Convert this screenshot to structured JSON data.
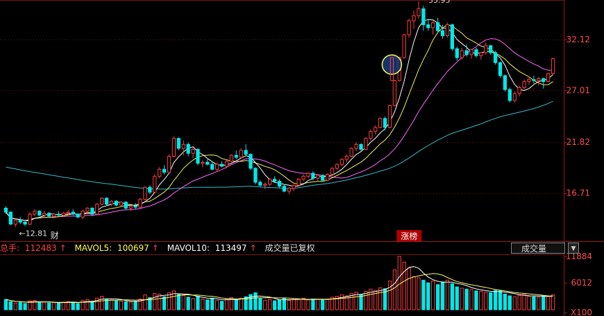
{
  "chart_data": [
    {
      "type": "candlestick",
      "title": "",
      "y_ticks": [
        "32.12",
        "27.01",
        "21.82",
        "16.71"
      ],
      "y_tick_values": [
        32.12,
        27.01,
        21.82,
        16.71
      ],
      "ylim": [
        12.0,
        36.0
      ],
      "annotations": {
        "low": "12.81",
        "high": "35.95",
        "low_tag": "财",
        "high_tag": "涨榜"
      },
      "ohlc": [
        [
          15.2,
          15.4,
          14.6,
          14.8
        ],
        [
          14.8,
          14.9,
          13.5,
          13.6
        ],
        [
          13.6,
          14.2,
          13.3,
          14.0
        ],
        [
          14.0,
          14.3,
          13.6,
          13.8
        ],
        [
          13.8,
          14.0,
          13.4,
          13.6
        ],
        [
          13.6,
          14.8,
          13.5,
          14.6
        ],
        [
          14.6,
          15.1,
          14.4,
          14.9
        ],
        [
          14.9,
          15.0,
          14.4,
          14.5
        ],
        [
          14.5,
          14.9,
          14.3,
          14.7
        ],
        [
          14.7,
          14.8,
          14.3,
          14.4
        ],
        [
          14.4,
          14.7,
          14.2,
          14.6
        ],
        [
          14.6,
          14.9,
          14.4,
          14.5
        ],
        [
          14.5,
          14.8,
          14.3,
          14.7
        ],
        [
          14.7,
          15.0,
          14.5,
          14.8
        ],
        [
          14.8,
          15.1,
          14.5,
          14.6
        ],
        [
          14.6,
          14.7,
          14.2,
          14.3
        ],
        [
          14.3,
          15.0,
          14.1,
          14.9
        ],
        [
          14.9,
          15.3,
          14.6,
          15.2
        ],
        [
          15.2,
          15.3,
          14.4,
          14.6
        ],
        [
          14.6,
          15.7,
          14.5,
          15.6
        ],
        [
          15.6,
          16.3,
          15.5,
          16.2
        ],
        [
          16.2,
          16.3,
          15.4,
          15.6
        ],
        [
          15.6,
          16.0,
          15.4,
          15.9
        ],
        [
          15.9,
          16.0,
          15.4,
          15.5
        ],
        [
          15.5,
          15.9,
          15.3,
          15.8
        ],
        [
          15.8,
          15.9,
          15.0,
          15.2
        ],
        [
          15.2,
          15.5,
          14.9,
          15.4
        ],
        [
          15.4,
          15.7,
          15.1,
          15.3
        ],
        [
          15.3,
          16.2,
          15.2,
          16.1
        ],
        [
          16.1,
          17.4,
          16.0,
          17.3
        ],
        [
          17.3,
          17.5,
          16.6,
          16.8
        ],
        [
          16.8,
          18.6,
          16.7,
          18.4
        ],
        [
          18.4,
          19.3,
          18.2,
          19.1
        ],
        [
          19.1,
          19.5,
          18.6,
          18.8
        ],
        [
          18.8,
          20.6,
          18.7,
          20.4
        ],
        [
          20.4,
          22.4,
          20.3,
          22.2
        ],
        [
          22.2,
          22.3,
          21.0,
          21.2
        ],
        [
          21.2,
          22.0,
          20.5,
          21.6
        ],
        [
          21.6,
          21.8,
          20.4,
          20.7
        ],
        [
          20.7,
          21.3,
          20.2,
          21.1
        ],
        [
          21.1,
          21.2,
          19.5,
          19.7
        ],
        [
          19.7,
          20.0,
          19.3,
          19.8
        ],
        [
          19.8,
          20.1,
          19.5,
          19.6
        ],
        [
          19.6,
          19.9,
          19.0,
          19.1
        ],
        [
          19.1,
          19.8,
          18.9,
          19.6
        ],
        [
          19.6,
          19.9,
          19.3,
          19.4
        ],
        [
          19.4,
          20.0,
          19.2,
          19.9
        ],
        [
          19.9,
          20.6,
          19.8,
          20.5
        ],
        [
          20.5,
          21.0,
          20.1,
          20.3
        ],
        [
          20.3,
          21.2,
          20.2,
          21.0
        ],
        [
          21.0,
          21.6,
          20.4,
          20.6
        ],
        [
          20.6,
          20.7,
          19.0,
          19.2
        ],
        [
          19.2,
          19.3,
          17.6,
          17.8
        ],
        [
          17.8,
          18.0,
          17.3,
          17.5
        ],
        [
          17.5,
          17.8,
          17.1,
          17.6
        ],
        [
          17.6,
          18.2,
          17.4,
          18.1
        ],
        [
          18.1,
          18.4,
          17.8,
          17.9
        ],
        [
          17.9,
          18.1,
          17.2,
          17.4
        ],
        [
          17.4,
          17.6,
          16.8,
          16.9
        ],
        [
          16.9,
          17.3,
          16.6,
          17.2
        ],
        [
          17.2,
          17.6,
          16.9,
          17.5
        ],
        [
          17.5,
          18.2,
          17.4,
          18.1
        ],
        [
          18.1,
          18.6,
          17.9,
          18.4
        ],
        [
          18.4,
          18.8,
          18.2,
          18.7
        ],
        [
          18.7,
          18.9,
          18.0,
          18.2
        ],
        [
          18.2,
          18.6,
          17.9,
          18.5
        ],
        [
          18.5,
          18.6,
          17.9,
          18.0
        ],
        [
          18.0,
          18.7,
          17.9,
          18.6
        ],
        [
          18.6,
          19.3,
          18.5,
          19.2
        ],
        [
          19.2,
          19.7,
          19.0,
          19.6
        ],
        [
          19.6,
          20.2,
          19.4,
          20.1
        ],
        [
          20.1,
          20.6,
          19.8,
          20.4
        ],
        [
          20.4,
          21.3,
          20.3,
          21.2
        ],
        [
          21.2,
          21.8,
          20.9,
          21.6
        ],
        [
          21.6,
          21.7,
          20.9,
          21.1
        ],
        [
          21.1,
          22.3,
          21.0,
          22.2
        ],
        [
          22.2,
          23.1,
          22.0,
          22.9
        ],
        [
          22.9,
          23.5,
          22.6,
          23.3
        ],
        [
          23.3,
          24.3,
          23.2,
          24.2
        ],
        [
          24.2,
          24.4,
          23.0,
          23.3
        ],
        [
          23.3,
          25.6,
          23.2,
          25.5
        ],
        [
          25.5,
          28.1,
          25.4,
          28.0
        ],
        [
          28.0,
          30.4,
          27.9,
          30.3
        ],
        [
          30.3,
          32.7,
          30.2,
          32.6
        ],
        [
          32.6,
          34.2,
          32.3,
          34.0
        ],
        [
          34.0,
          35.0,
          33.2,
          34.5
        ],
        [
          34.5,
          35.95,
          34.2,
          35.2
        ],
        [
          35.2,
          35.5,
          33.0,
          33.6
        ],
        [
          33.6,
          34.2,
          33.0,
          33.3
        ],
        [
          33.3,
          34.0,
          32.6,
          33.8
        ],
        [
          33.8,
          34.3,
          32.8,
          33.0
        ],
        [
          33.0,
          33.6,
          32.2,
          32.5
        ],
        [
          32.5,
          33.8,
          32.3,
          33.6
        ],
        [
          33.6,
          33.7,
          31.0,
          31.2
        ],
        [
          31.2,
          31.4,
          30.0,
          30.3
        ],
        [
          30.3,
          31.3,
          30.1,
          31.0
        ],
        [
          31.0,
          31.6,
          30.4,
          30.6
        ],
        [
          30.6,
          31.2,
          30.2,
          31.1
        ],
        [
          31.1,
          31.3,
          30.3,
          30.5
        ],
        [
          30.5,
          30.9,
          30.1,
          30.8
        ],
        [
          30.8,
          31.8,
          30.6,
          31.5
        ],
        [
          31.5,
          31.6,
          30.6,
          30.8
        ],
        [
          30.8,
          31.0,
          29.6,
          29.8
        ],
        [
          29.8,
          29.9,
          28.3,
          28.5
        ],
        [
          28.5,
          28.6,
          26.9,
          27.1
        ],
        [
          27.1,
          27.3,
          25.8,
          26.0
        ],
        [
          26.0,
          26.9,
          25.8,
          26.7
        ],
        [
          26.7,
          27.5,
          26.4,
          27.3
        ],
        [
          27.3,
          28.1,
          27.1,
          27.9
        ],
        [
          27.9,
          28.4,
          27.6,
          28.1
        ],
        [
          28.1,
          28.5,
          27.7,
          28.0
        ],
        [
          28.0,
          28.4,
          27.5,
          28.2
        ],
        [
          28.2,
          28.3,
          27.2,
          27.9
        ],
        [
          27.9,
          28.8,
          27.8,
          28.7
        ],
        [
          28.7,
          30.3,
          28.6,
          30.2
        ]
      ],
      "volume": [
        2300,
        1800,
        1500,
        1600,
        1400,
        2000,
        2100,
        1600,
        1700,
        1500,
        1600,
        1500,
        1700,
        1800,
        1600,
        1400,
        2100,
        2300,
        1900,
        2600,
        3000,
        2400,
        2200,
        2000,
        1900,
        1800,
        1700,
        1900,
        2400,
        3300,
        2700,
        3600,
        3500,
        2900,
        3800,
        4200,
        3400,
        3200,
        2800,
        2500,
        3000,
        2400,
        2200,
        2600,
        2100,
        1900,
        2300,
        2700,
        2400,
        2600,
        2900,
        3400,
        3800,
        2500,
        2100,
        2300,
        2000,
        2200,
        2600,
        2100,
        2300,
        2400,
        2600,
        2200,
        2400,
        2300,
        2200,
        2400,
        2800,
        3000,
        3300,
        3100,
        3600,
        3900,
        3400,
        4100,
        4600,
        4300,
        4900,
        4700,
        6400,
        8900,
        11884,
        10600,
        9300,
        7400,
        7100,
        6600,
        6000,
        6400,
        5600,
        6200,
        6600,
        5800,
        5100,
        4800,
        4600,
        4500,
        4200,
        4100,
        3900,
        3800,
        4300,
        4200,
        3500,
        3100,
        2900,
        3200,
        3400,
        3000,
        2900,
        2800,
        3100,
        3000,
        3300
      ],
      "moving_averages": [
        "MA5",
        "MA10",
        "MA20",
        "MA60"
      ]
    }
  ],
  "volume_panel": {
    "legend": [
      {
        "label": "总手: ",
        "value": "112483",
        "color": "#ff4040",
        "arrow": "↑",
        "arrow_color": "#ff4040"
      },
      {
        "label": "MAVOL5: ",
        "value": "100697",
        "color": "#ffff4a",
        "arrow": "↑",
        "arrow_color": "#ff4040"
      },
      {
        "label": "MAVOL10: ",
        "value": "113497",
        "color": "#ffffff",
        "arrow": "↑",
        "arrow_color": "#ff4040"
      }
    ],
    "note": "成交量已复权",
    "selector": "成交量",
    "y_ticks": [
      "11884",
      "6012",
      "X100"
    ]
  },
  "colors": {
    "up": "#ff3d3d",
    "down": "#00e8e8",
    "ma5": "#ffffff",
    "ma10": "#f0f060",
    "ma20": "#ff66ff",
    "ma60": "#33bbcc",
    "grid": "#7a0f0f",
    "axis": "#a31818",
    "vol_ma5": "#ffffff",
    "vol_ma10": "#ffff66"
  }
}
